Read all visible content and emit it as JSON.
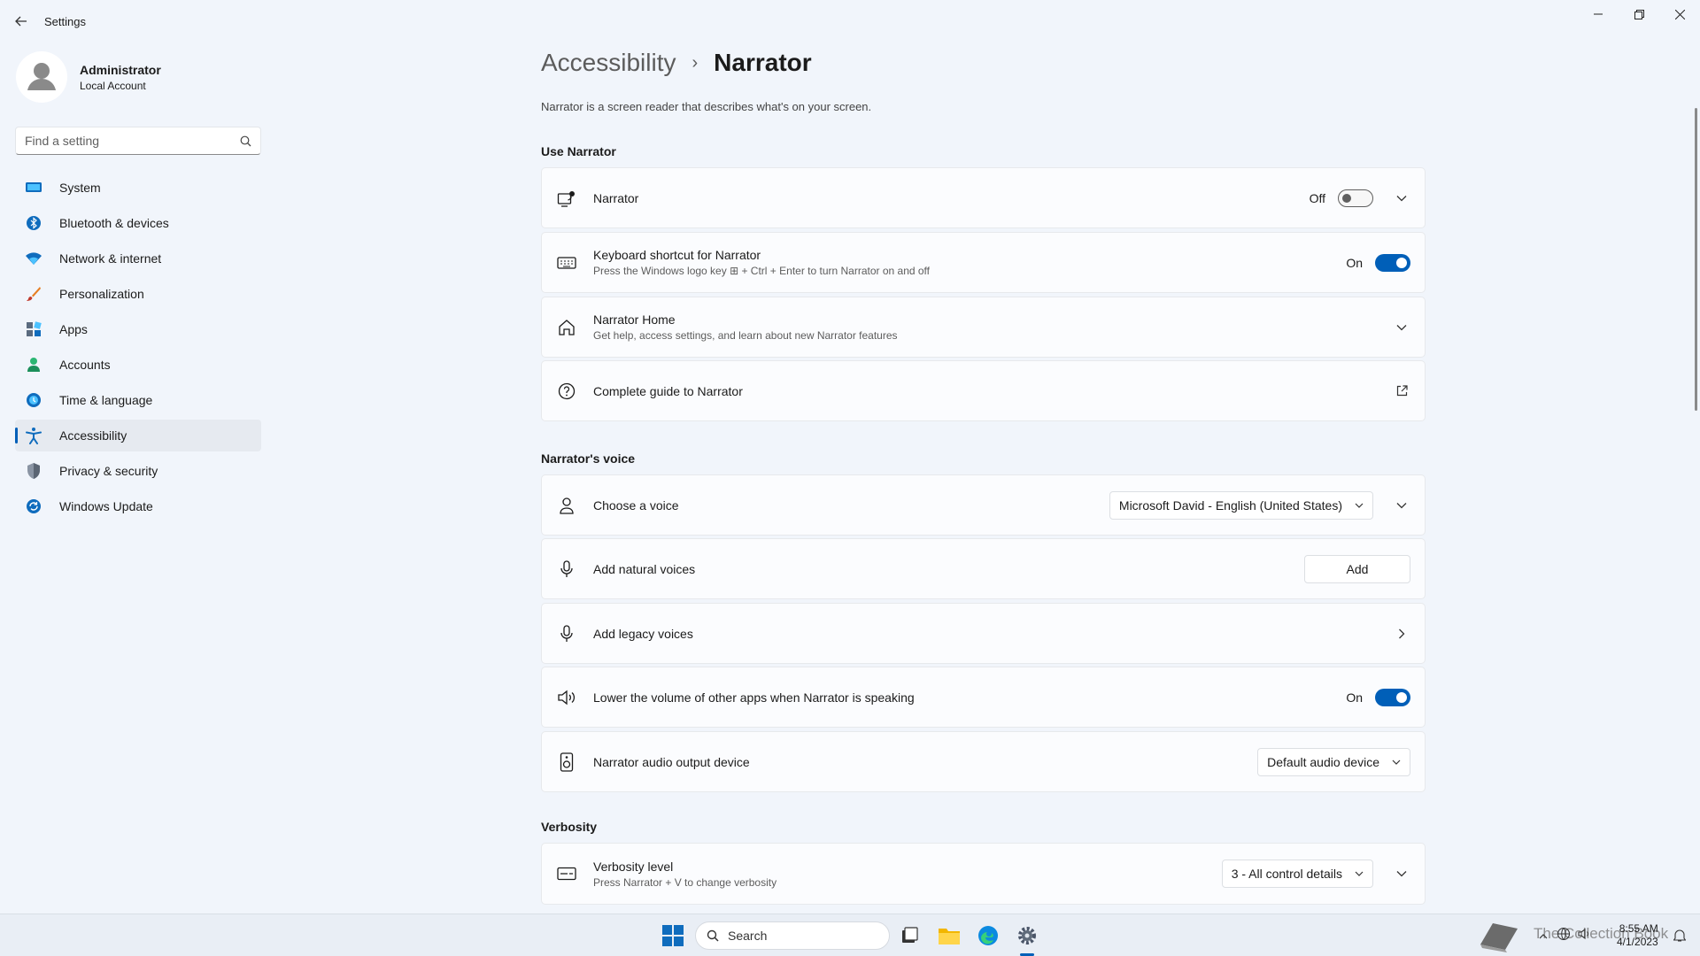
{
  "window": {
    "title": "Settings",
    "minimize_glyph": "—",
    "maximize_glyph": "❐",
    "close_glyph": "✕"
  },
  "profile": {
    "name": "Administrator",
    "account_type": "Local Account"
  },
  "search": {
    "placeholder": "Find a setting"
  },
  "nav": {
    "items": [
      {
        "label": "System",
        "icon": "system-icon"
      },
      {
        "label": "Bluetooth & devices",
        "icon": "bluetooth-icon"
      },
      {
        "label": "Network & internet",
        "icon": "wifi-icon"
      },
      {
        "label": "Personalization",
        "icon": "brush-icon"
      },
      {
        "label": "Apps",
        "icon": "apps-icon"
      },
      {
        "label": "Accounts",
        "icon": "accounts-icon"
      },
      {
        "label": "Time & language",
        "icon": "globe-clock-icon"
      },
      {
        "label": "Accessibility",
        "icon": "accessibility-icon",
        "active": true
      },
      {
        "label": "Privacy & security",
        "icon": "shield-icon"
      },
      {
        "label": "Windows Update",
        "icon": "update-icon"
      }
    ]
  },
  "breadcrumb": {
    "parent": "Accessibility",
    "separator": "›",
    "current": "Narrator"
  },
  "description": "Narrator is a screen reader that describes what's on your screen.",
  "sections": {
    "use_narrator": "Use Narrator",
    "narrators_voice": "Narrator's voice",
    "verbosity": "Verbosity"
  },
  "cards": {
    "narrator": {
      "title": "Narrator",
      "state": "Off",
      "toggle_on": false
    },
    "keyboard_shortcut": {
      "title": "Keyboard shortcut for Narrator",
      "subtitle": "Press the Windows logo key ⊞ + Ctrl + Enter to turn Narrator on and off",
      "state": "On",
      "toggle_on": true
    },
    "narrator_home": {
      "title": "Narrator Home",
      "subtitle": "Get help, access settings, and learn about new Narrator features"
    },
    "complete_guide": {
      "title": "Complete guide to Narrator"
    },
    "choose_voice": {
      "title": "Choose a voice",
      "selected": "Microsoft David - English (United States)"
    },
    "natural_voices": {
      "title": "Add natural voices",
      "button": "Add"
    },
    "legacy_voices": {
      "title": "Add legacy voices"
    },
    "lower_volume": {
      "title": "Lower the volume of other apps when Narrator is speaking",
      "state": "On",
      "toggle_on": true
    },
    "audio_output": {
      "title": "Narrator audio output device",
      "selected": "Default audio device"
    },
    "verbosity_level": {
      "title": "Verbosity level",
      "subtitle": "Press Narrator + V to change verbosity",
      "selected": "3 - All control details"
    }
  },
  "taskbar": {
    "search_label": "Search",
    "watermark": "The Collection Book",
    "time": "8:55 AM",
    "date": "4/1/2023"
  },
  "colors": {
    "accent": "#005fb8",
    "background": "#f1f5fb",
    "card": "#fbfcfe"
  }
}
